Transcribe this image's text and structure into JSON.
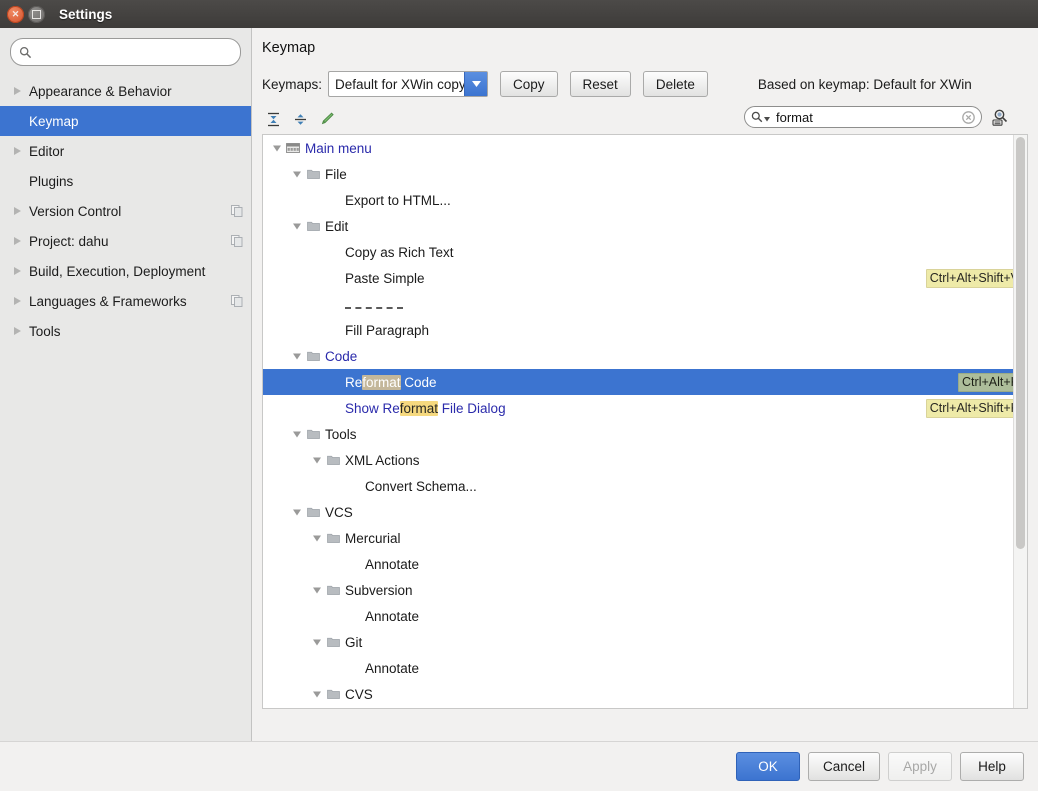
{
  "window": {
    "title": "Settings",
    "close_icon": "close-icon",
    "maximize_icon": "maximize-icon"
  },
  "sidebar": {
    "search": {
      "value": "",
      "placeholder": "",
      "icon": "search-icon"
    },
    "items": [
      {
        "label": "Appearance & Behavior",
        "expandable": true,
        "selected": false,
        "badge": false
      },
      {
        "label": "Keymap",
        "expandable": false,
        "selected": true,
        "badge": false
      },
      {
        "label": "Editor",
        "expandable": true,
        "selected": false,
        "badge": false
      },
      {
        "label": "Plugins",
        "expandable": false,
        "selected": false,
        "badge": false
      },
      {
        "label": "Version Control",
        "expandable": true,
        "selected": false,
        "badge": true
      },
      {
        "label": "Project: dahu",
        "expandable": true,
        "selected": false,
        "badge": true
      },
      {
        "label": "Build, Execution, Deployment",
        "expandable": true,
        "selected": false,
        "badge": false
      },
      {
        "label": "Languages & Frameworks",
        "expandable": true,
        "selected": false,
        "badge": true
      },
      {
        "label": "Tools",
        "expandable": true,
        "selected": false,
        "badge": false
      }
    ]
  },
  "main": {
    "page_title": "Keymap",
    "keymaps_label": "Keymaps:",
    "keymap_selected": "Default for XWin copy",
    "copy_button": "Copy",
    "reset_button": "Reset",
    "delete_button": "Delete",
    "based_on": "Based on keymap: Default for XWin",
    "toolbar": {
      "expand_all_icon": "expand-all-icon",
      "collapse_all_icon": "collapse-all-icon",
      "edit_shortcut_icon": "edit-pencil-icon"
    },
    "find": {
      "value": "format",
      "placeholder": "",
      "search_icon": "search-icon",
      "clear_icon": "clear-icon",
      "by_shortcut_icon": "find-by-shortcut-icon"
    }
  },
  "tree": [
    {
      "indent": 0,
      "twig": "down",
      "icon": "menu-bar-icon",
      "text": "Main menu",
      "blue": true,
      "shortcut": "",
      "selected": false,
      "sep": false,
      "highlight": ""
    },
    {
      "indent": 1,
      "twig": "down",
      "icon": "folder-icon",
      "text": "File",
      "blue": false,
      "shortcut": "",
      "selected": false,
      "sep": false,
      "highlight": ""
    },
    {
      "indent": 2,
      "twig": "none",
      "icon": "none",
      "text": "Export to HTML...",
      "blue": false,
      "shortcut": "",
      "selected": false,
      "sep": false,
      "highlight": ""
    },
    {
      "indent": 1,
      "twig": "down",
      "icon": "folder-icon",
      "text": "Edit",
      "blue": false,
      "shortcut": "",
      "selected": false,
      "sep": false,
      "highlight": ""
    },
    {
      "indent": 2,
      "twig": "none",
      "icon": "none",
      "text": "Copy as Rich Text",
      "blue": false,
      "shortcut": "",
      "selected": false,
      "sep": false,
      "highlight": ""
    },
    {
      "indent": 2,
      "twig": "none",
      "icon": "none",
      "text": "Paste Simple",
      "blue": false,
      "shortcut": "Ctrl+Alt+Shift+V",
      "selected": false,
      "sep": false,
      "highlight": ""
    },
    {
      "indent": 2,
      "twig": "none",
      "icon": "none",
      "text": "",
      "blue": false,
      "shortcut": "",
      "selected": false,
      "sep": true,
      "highlight": ""
    },
    {
      "indent": 2,
      "twig": "none",
      "icon": "none",
      "text": "Fill Paragraph",
      "blue": false,
      "shortcut": "",
      "selected": false,
      "sep": false,
      "highlight": ""
    },
    {
      "indent": 1,
      "twig": "down",
      "icon": "folder-icon",
      "text": "Code",
      "blue": true,
      "shortcut": "",
      "selected": false,
      "sep": false,
      "highlight": ""
    },
    {
      "indent": 2,
      "twig": "none",
      "icon": "none",
      "text": "Reformat Code",
      "blue": true,
      "shortcut": "Ctrl+Alt+K",
      "selected": true,
      "sep": false,
      "highlight": "format"
    },
    {
      "indent": 2,
      "twig": "none",
      "icon": "none",
      "text": "Show Reformat File Dialog",
      "blue": true,
      "shortcut": "Ctrl+Alt+Shift+K",
      "selected": false,
      "sep": false,
      "highlight": "format"
    },
    {
      "indent": 1,
      "twig": "down",
      "icon": "folder-icon",
      "text": "Tools",
      "blue": false,
      "shortcut": "",
      "selected": false,
      "sep": false,
      "highlight": ""
    },
    {
      "indent": 2,
      "twig": "down",
      "icon": "folder-icon",
      "text": "XML Actions",
      "blue": false,
      "shortcut": "",
      "selected": false,
      "sep": false,
      "highlight": ""
    },
    {
      "indent": 3,
      "twig": "none",
      "icon": "none",
      "text": "Convert Schema...",
      "blue": false,
      "shortcut": "",
      "selected": false,
      "sep": false,
      "highlight": ""
    },
    {
      "indent": 1,
      "twig": "down",
      "icon": "folder-icon",
      "text": "VCS",
      "blue": false,
      "shortcut": "",
      "selected": false,
      "sep": false,
      "highlight": ""
    },
    {
      "indent": 2,
      "twig": "down",
      "icon": "folder-icon",
      "text": "Mercurial",
      "blue": false,
      "shortcut": "",
      "selected": false,
      "sep": false,
      "highlight": ""
    },
    {
      "indent": 3,
      "twig": "none",
      "icon": "none",
      "text": "Annotate",
      "blue": false,
      "shortcut": "",
      "selected": false,
      "sep": false,
      "highlight": ""
    },
    {
      "indent": 2,
      "twig": "down",
      "icon": "folder-icon",
      "text": "Subversion",
      "blue": false,
      "shortcut": "",
      "selected": false,
      "sep": false,
      "highlight": ""
    },
    {
      "indent": 3,
      "twig": "none",
      "icon": "none",
      "text": "Annotate",
      "blue": false,
      "shortcut": "",
      "selected": false,
      "sep": false,
      "highlight": ""
    },
    {
      "indent": 2,
      "twig": "down",
      "icon": "folder-icon",
      "text": "Git",
      "blue": false,
      "shortcut": "",
      "selected": false,
      "sep": false,
      "highlight": ""
    },
    {
      "indent": 3,
      "twig": "none",
      "icon": "none",
      "text": "Annotate",
      "blue": false,
      "shortcut": "",
      "selected": false,
      "sep": false,
      "highlight": ""
    },
    {
      "indent": 2,
      "twig": "down",
      "icon": "folder-icon",
      "text": "CVS",
      "blue": false,
      "shortcut": "",
      "selected": false,
      "sep": false,
      "highlight": ""
    }
  ],
  "footer": {
    "ok": "OK",
    "cancel": "Cancel",
    "apply": "Apply",
    "help": "Help"
  },
  "colors": {
    "selection_blue": "#3c74d0",
    "link_blue": "#2a2aab",
    "highlight_yellow": "#f6d97f",
    "shortcut_badge": "#eeeaa8",
    "titlebar": "#443f3d"
  }
}
